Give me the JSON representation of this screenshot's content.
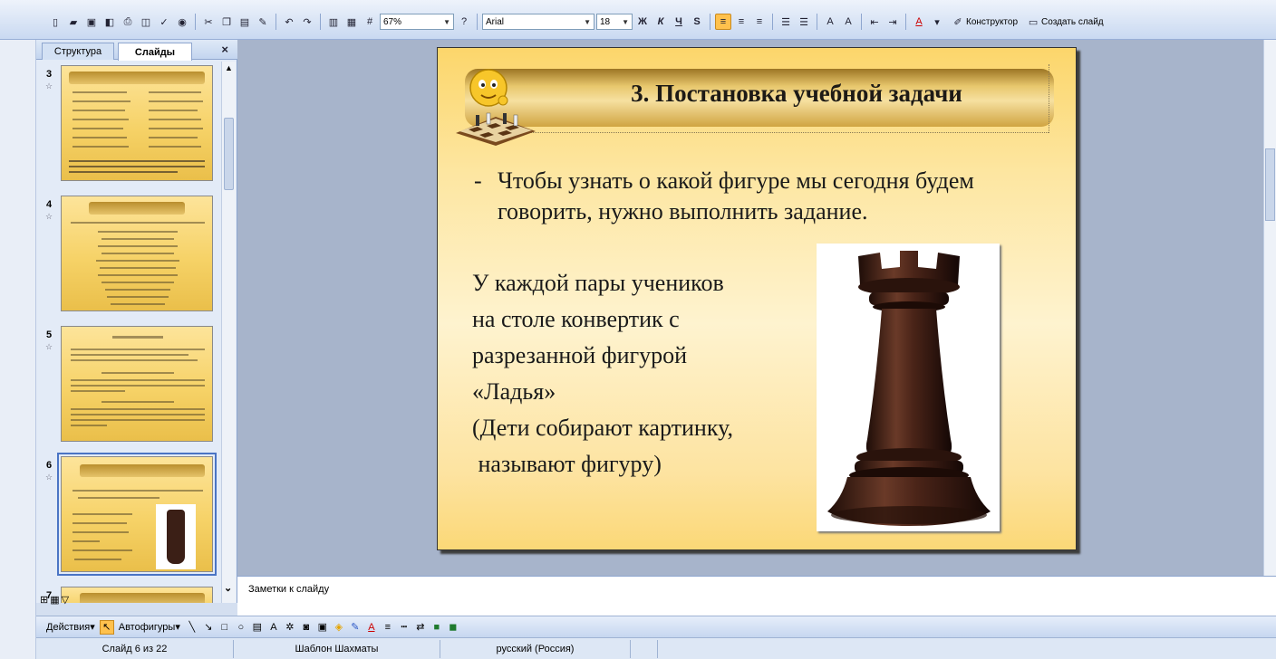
{
  "toolbar": {
    "zoom": "67%",
    "font_name": "Arial",
    "font_size": "18",
    "bold_glyph": "Ж",
    "italic_glyph": "К",
    "underline_glyph": "Ч",
    "shadow_glyph": "S",
    "designer_label": "Конструктор",
    "new_slide_label": "Создать слайд"
  },
  "side_panel": {
    "tabs": [
      "Структура",
      "Слайды"
    ],
    "active_tab": "Слайды",
    "thumbnails": [
      {
        "number": "3",
        "title": "3. Предварительная беседа"
      },
      {
        "number": "4",
        "title": "5. Загадки о шахматах"
      },
      {
        "number": "5",
        "title": "Работа в группах"
      },
      {
        "number": "6",
        "title": "3. Постановка учебной задачи"
      },
      {
        "number": "7",
        "title": ""
      }
    ],
    "selected_thumbnail": "6"
  },
  "slide": {
    "title": "3. Постановка учебной задачи",
    "bullet_dash": "-",
    "bullet": "Чтобы узнать о какой фигуре мы сегодня будем говорить, нужно выполнить задание.",
    "body": "У каждой пары учеников\nна столе конвертик с\nразрезанной фигурой\n«Ладья»\n(Дети собирают картинку,\n называют фигуру)"
  },
  "notes": {
    "label": "Заметки к слайду"
  },
  "drawbar": {
    "actions_label": "Действия",
    "autoshapes_label": "Автофигуры"
  },
  "status": {
    "slide_position": "Слайд 6 из 22",
    "template": "Шаблон Шахматы",
    "language": "русский (Россия)"
  },
  "colors": {
    "slide_top": "#fcd66b",
    "slide_mid": "#fef3cf",
    "title_band": "#c9a24a",
    "workspace": "#a7b4cb"
  }
}
